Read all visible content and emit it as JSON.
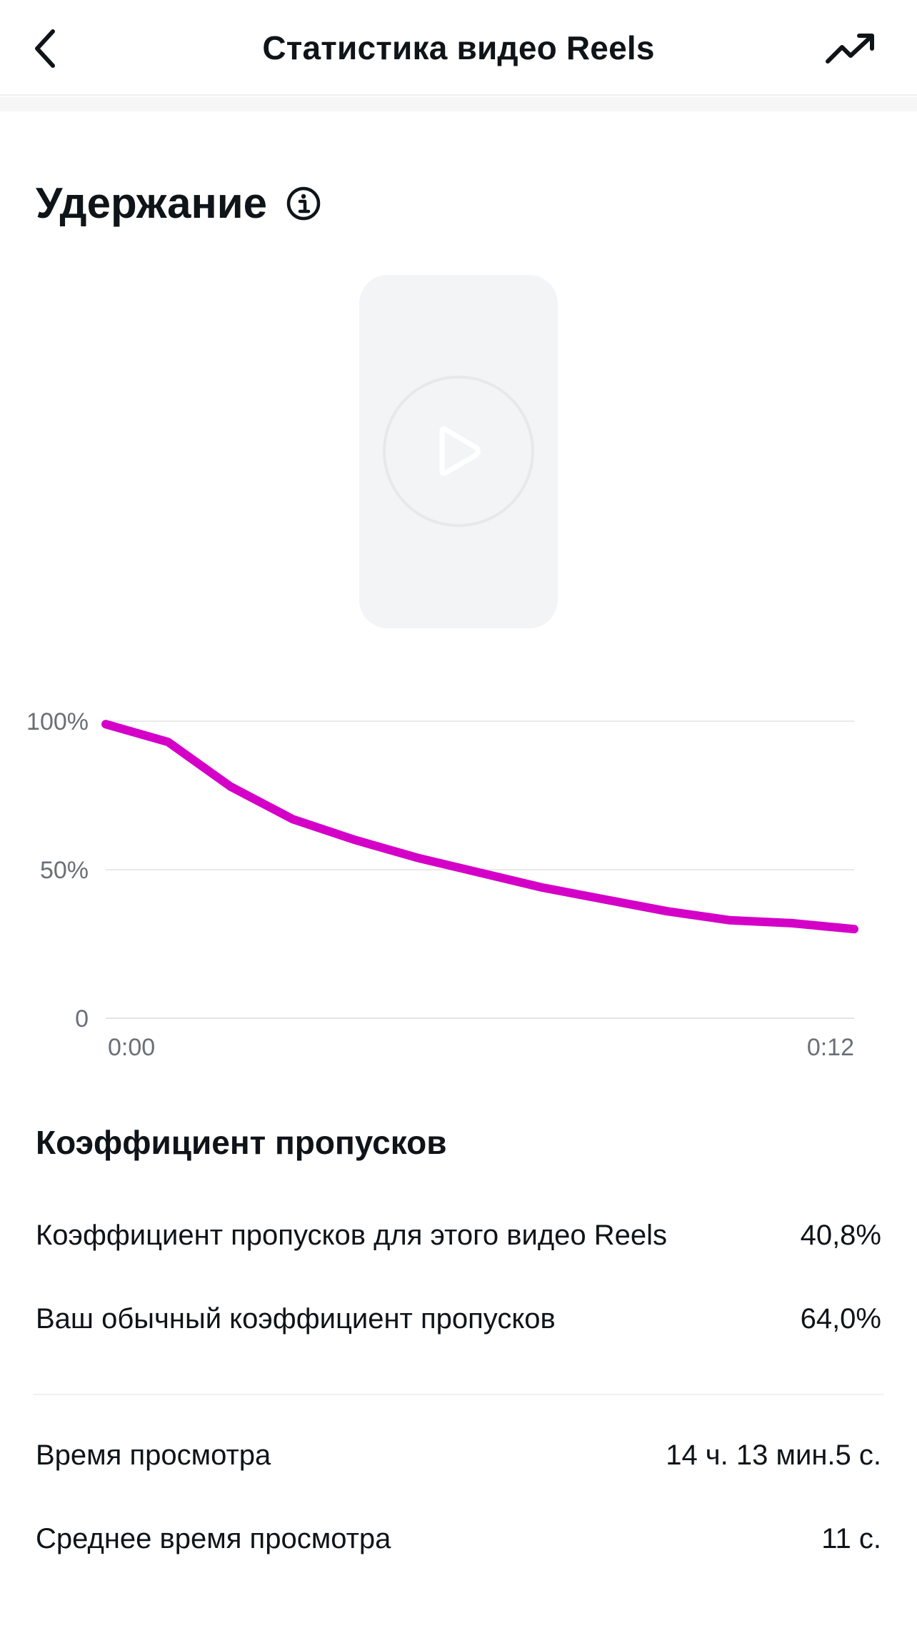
{
  "header": {
    "title": "Статистика видео Reels",
    "back_icon": "chevron-left-icon",
    "trend_icon": "trending-up-icon"
  },
  "retention": {
    "title": "Удержание",
    "info_icon": "info-icon",
    "play_icon": "play-icon"
  },
  "chart_data": {
    "type": "line",
    "title": "",
    "xlabel": "",
    "ylabel": "",
    "x_tick_labels": [
      "0:00",
      "0:12"
    ],
    "y_tick_labels": [
      "100%",
      "50%",
      "0"
    ],
    "x": [
      0,
      1,
      2,
      3,
      4,
      5,
      6,
      7,
      8,
      9,
      10,
      11,
      12
    ],
    "series": [
      {
        "color": "#d400c8",
        "values": [
          99,
          93,
          78,
          67,
          60,
          54,
          49,
          44,
          40,
          36,
          33,
          32,
          30
        ]
      }
    ],
    "xlim": [
      0,
      12
    ],
    "ylim": [
      0,
      100
    ],
    "grid": true,
    "legend": "none"
  },
  "skip_rate": {
    "title": "Коэффициент пропусков",
    "rows": [
      {
        "label": "Коэффициент пропусков для этого видео Reels",
        "value": "40,8%"
      },
      {
        "label": "Ваш обычный коэффициент пропусков",
        "value": "64,0%"
      }
    ]
  },
  "watch_time": {
    "rows": [
      {
        "label": "Время просмотра",
        "value": "14 ч. 13 мин.5 с."
      },
      {
        "label": "Среднее время просмотра",
        "value": "11 с."
      }
    ]
  },
  "colors": {
    "accent": "#d400c8",
    "text": "#0f1419",
    "muted": "#6b6f76",
    "grid": "#e6e7e9",
    "thumb": "#f3f4f5"
  }
}
